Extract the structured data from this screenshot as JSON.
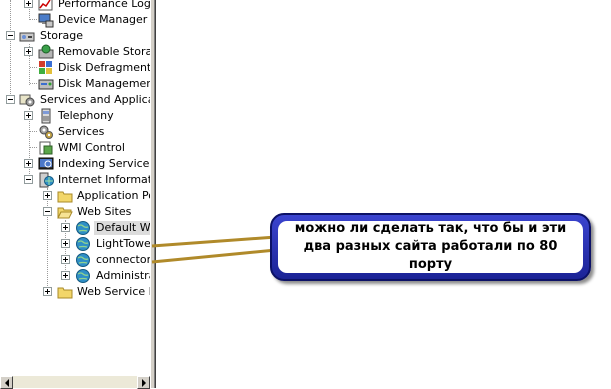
{
  "tree": {
    "items": [
      {
        "label": "Performance Logs a",
        "icon": "performance-logs-icon"
      },
      {
        "label": "Device Manager",
        "icon": "device-manager-icon"
      },
      {
        "label": "Storage",
        "icon": "storage-icon"
      },
      {
        "label": "Removable Storage",
        "icon": "removable-storage-icon"
      },
      {
        "label": "Disk Defragmenter",
        "icon": "disk-defragmenter-icon"
      },
      {
        "label": "Disk Management",
        "icon": "disk-management-icon"
      },
      {
        "label": "Services and Application",
        "icon": "services-applications-icon"
      },
      {
        "label": "Telephony",
        "icon": "telephony-icon"
      },
      {
        "label": "Services",
        "icon": "services-gear-icon"
      },
      {
        "label": "WMI Control",
        "icon": "wmi-control-icon"
      },
      {
        "label": "Indexing Service",
        "icon": "indexing-service-icon"
      },
      {
        "label": "Internet Informatio",
        "icon": "iis-server-icon"
      },
      {
        "label": "Application Poo",
        "icon": "folder-icon"
      },
      {
        "label": "Web Sites",
        "icon": "folder-open-icon"
      },
      {
        "label": "Default We",
        "icon": "website-globe-icon"
      },
      {
        "label": "LightTower",
        "icon": "website-globe-icon"
      },
      {
        "label": "connectorp",
        "icon": "website-globe-icon"
      },
      {
        "label": "Administrat",
        "icon": "website-globe-icon"
      },
      {
        "label": "Web Service Ex",
        "icon": "folder-icon"
      }
    ]
  },
  "callout": {
    "line1": "можно ли сделать так, что бы и эти",
    "line2": "два разных сайта работали по 80",
    "line3": "порту"
  },
  "colors": {
    "callout_border": "#2b34b8",
    "connector": "#b08a2a",
    "selection": "#dcdcdc"
  }
}
